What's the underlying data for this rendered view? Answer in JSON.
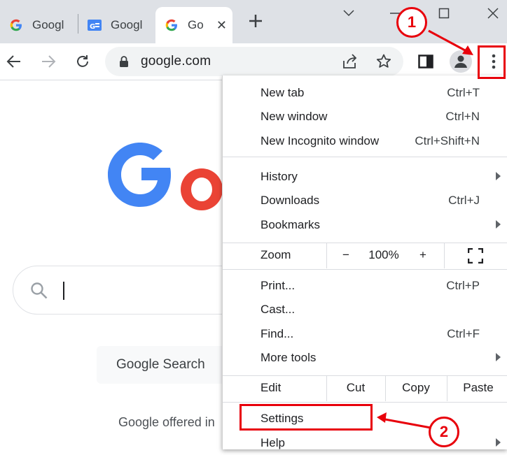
{
  "tabs": [
    {
      "title": "Googl",
      "favicon": "google-g-icon"
    },
    {
      "title": "Googl",
      "favicon": "google-news-icon"
    },
    {
      "title": "Go",
      "favicon": "google-g-icon",
      "active": true
    }
  ],
  "toolbar": {
    "url": "google.com"
  },
  "page": {
    "search_button": "Google Search",
    "offered_text": "Google offered in"
  },
  "menu": {
    "new_tab": {
      "label": "New tab",
      "shortcut": "Ctrl+T"
    },
    "new_window": {
      "label": "New window",
      "shortcut": "Ctrl+N"
    },
    "new_incognito": {
      "label": "New Incognito window",
      "shortcut": "Ctrl+Shift+N"
    },
    "history": {
      "label": "History"
    },
    "downloads": {
      "label": "Downloads",
      "shortcut": "Ctrl+J"
    },
    "bookmarks": {
      "label": "Bookmarks"
    },
    "zoom": {
      "label": "Zoom",
      "minus": "−",
      "value": "100%",
      "plus": "+"
    },
    "print": {
      "label": "Print...",
      "shortcut": "Ctrl+P"
    },
    "cast": {
      "label": "Cast..."
    },
    "find": {
      "label": "Find...",
      "shortcut": "Ctrl+F"
    },
    "more_tools": {
      "label": "More tools"
    },
    "edit": {
      "label": "Edit",
      "cut": "Cut",
      "copy": "Copy",
      "paste": "Paste"
    },
    "settings": {
      "label": "Settings"
    },
    "help": {
      "label": "Help"
    }
  },
  "annotations": {
    "step1": "1",
    "step2": "2",
    "color": "#e8000b"
  },
  "colors": {
    "google_blue": "#4285f4",
    "google_red": "#ea4335",
    "tabstrip_bg": "#dee1e6"
  }
}
